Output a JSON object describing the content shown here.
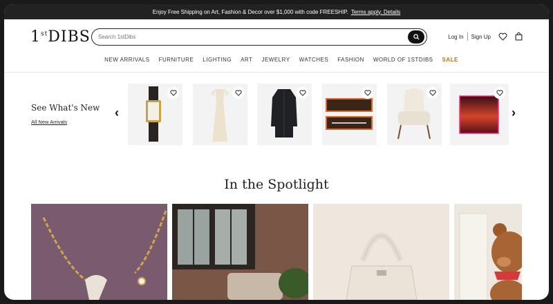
{
  "promo": {
    "text": "Enjoy Free Shipping on Art, Fashion & Decor over $1,000 with code FREESHIP.",
    "link": "Terms apply. Details"
  },
  "header": {
    "logo": "1stDIBS",
    "search_placeholder": "Search 1stDibs",
    "login": "Log In",
    "signup": "Sign Up"
  },
  "nav": {
    "items": [
      "NEW ARRIVALS",
      "FURNITURE",
      "LIGHTING",
      "ART",
      "JEWELRY",
      "WATCHES",
      "FASHION",
      "WORLD OF 1STDIBS"
    ],
    "sale": "SALE"
  },
  "whats_new": {
    "title": "See What's New",
    "link": "All New Arrivals"
  },
  "products": [
    {
      "name": "watch"
    },
    {
      "name": "gown"
    },
    {
      "name": "jacket"
    },
    {
      "name": "watch-box"
    },
    {
      "name": "armchair"
    },
    {
      "name": "painting"
    }
  ],
  "spotlight": {
    "title": "In the Spotlight"
  }
}
